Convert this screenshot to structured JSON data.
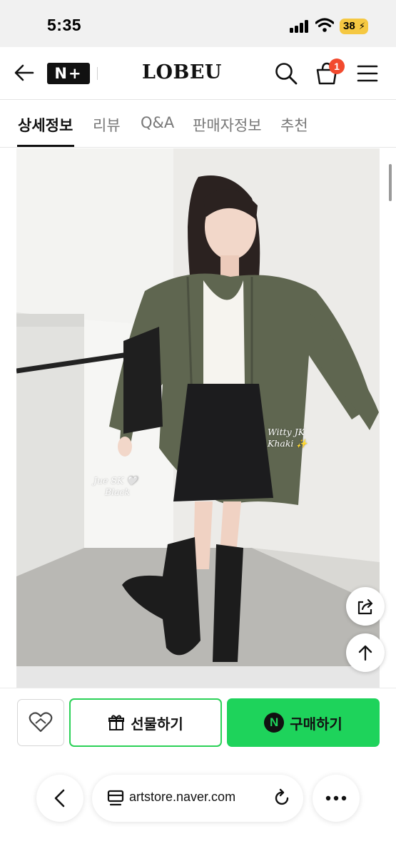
{
  "status_bar": {
    "time": "5:35",
    "battery": "38",
    "icons": [
      "cellular-signal-icon",
      "wifi-icon",
      "battery-charging-icon"
    ]
  },
  "header": {
    "nplus_label": "N+",
    "brand": "LOBEU",
    "cart_count": "1",
    "icons": [
      "back-arrow-icon",
      "search-icon",
      "cart-icon",
      "menu-icon"
    ]
  },
  "tabs": [
    {
      "label": "상세정보",
      "active": true
    },
    {
      "label": "리뷰",
      "active": false
    },
    {
      "label": "Q&A",
      "active": false
    },
    {
      "label": "판매자정보",
      "active": false
    },
    {
      "label": "추천",
      "active": false
    }
  ],
  "product_image": {
    "caption_left_line1": "Jue SK 🤍",
    "caption_left_line2": "Black",
    "caption_right_line1": "Witty JK",
    "caption_right_line2": "Khaki ✨"
  },
  "floating_buttons": [
    "share-icon",
    "scroll-to-top-icon"
  ],
  "purchase_bar": {
    "gift_label": "선물하기",
    "buy_label": "구매하기",
    "npay_mark": "N",
    "icons": [
      "wishlist-heart-icon",
      "gift-icon",
      "naver-pay-icon"
    ]
  },
  "browser": {
    "url": "artstore.naver.com",
    "icons": [
      "browser-back-icon",
      "reader-mode-icon",
      "reload-icon",
      "more-options-icon"
    ]
  },
  "colors": {
    "accent_green": "#1ed35b",
    "gift_border": "#2bd157",
    "cart_badge": "#f24a2e",
    "battery": "#f5c842"
  }
}
